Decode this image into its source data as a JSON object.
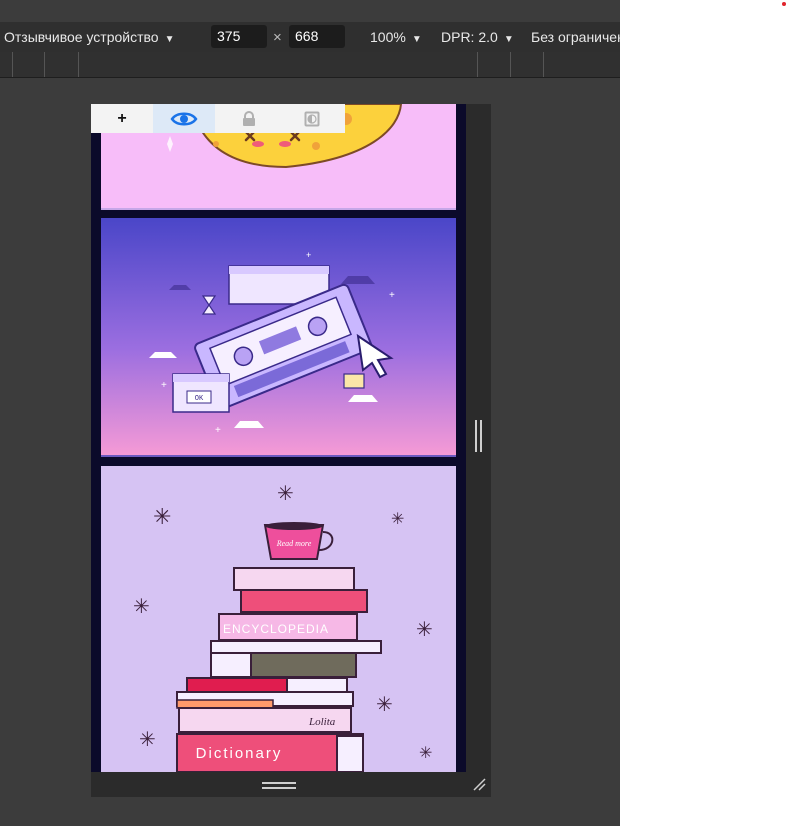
{
  "toolbar": {
    "device_mode": "Отзывчивое устройство",
    "width_value": "375",
    "times": "×",
    "height_value": "668",
    "zoom": "100%",
    "dpr": "DPR: 2.0",
    "throttling": "Без ограничен"
  },
  "mini_toolbar": {
    "items": [
      {
        "icon": "plus-icon",
        "glyph": "+",
        "active": false
      },
      {
        "icon": "eye-icon",
        "active": true
      },
      {
        "icon": "lock-icon",
        "active": false
      },
      {
        "icon": "contrast-icon",
        "active": false
      }
    ]
  },
  "panels": [
    {
      "name": "pizza-illustration",
      "bg": "#f7bdf9"
    },
    {
      "name": "cassette-illustration",
      "bg_top": "#4a46c8",
      "bg_bottom": "#f59ad6"
    },
    {
      "name": "books-illustration",
      "bg": "#d6c3f3",
      "cup_text": "Read more",
      "book_labels": [
        "ENCYCLOPEDIA",
        "Lolita",
        "Dictionary"
      ],
      "dialog_label": "OK"
    }
  ],
  "colors": {
    "devtools_bg": "#3c3c3c",
    "toolbar_bg": "#2f2f2f",
    "accent_blue": "#1a73e8",
    "page_bg": "#0b0a2a"
  }
}
